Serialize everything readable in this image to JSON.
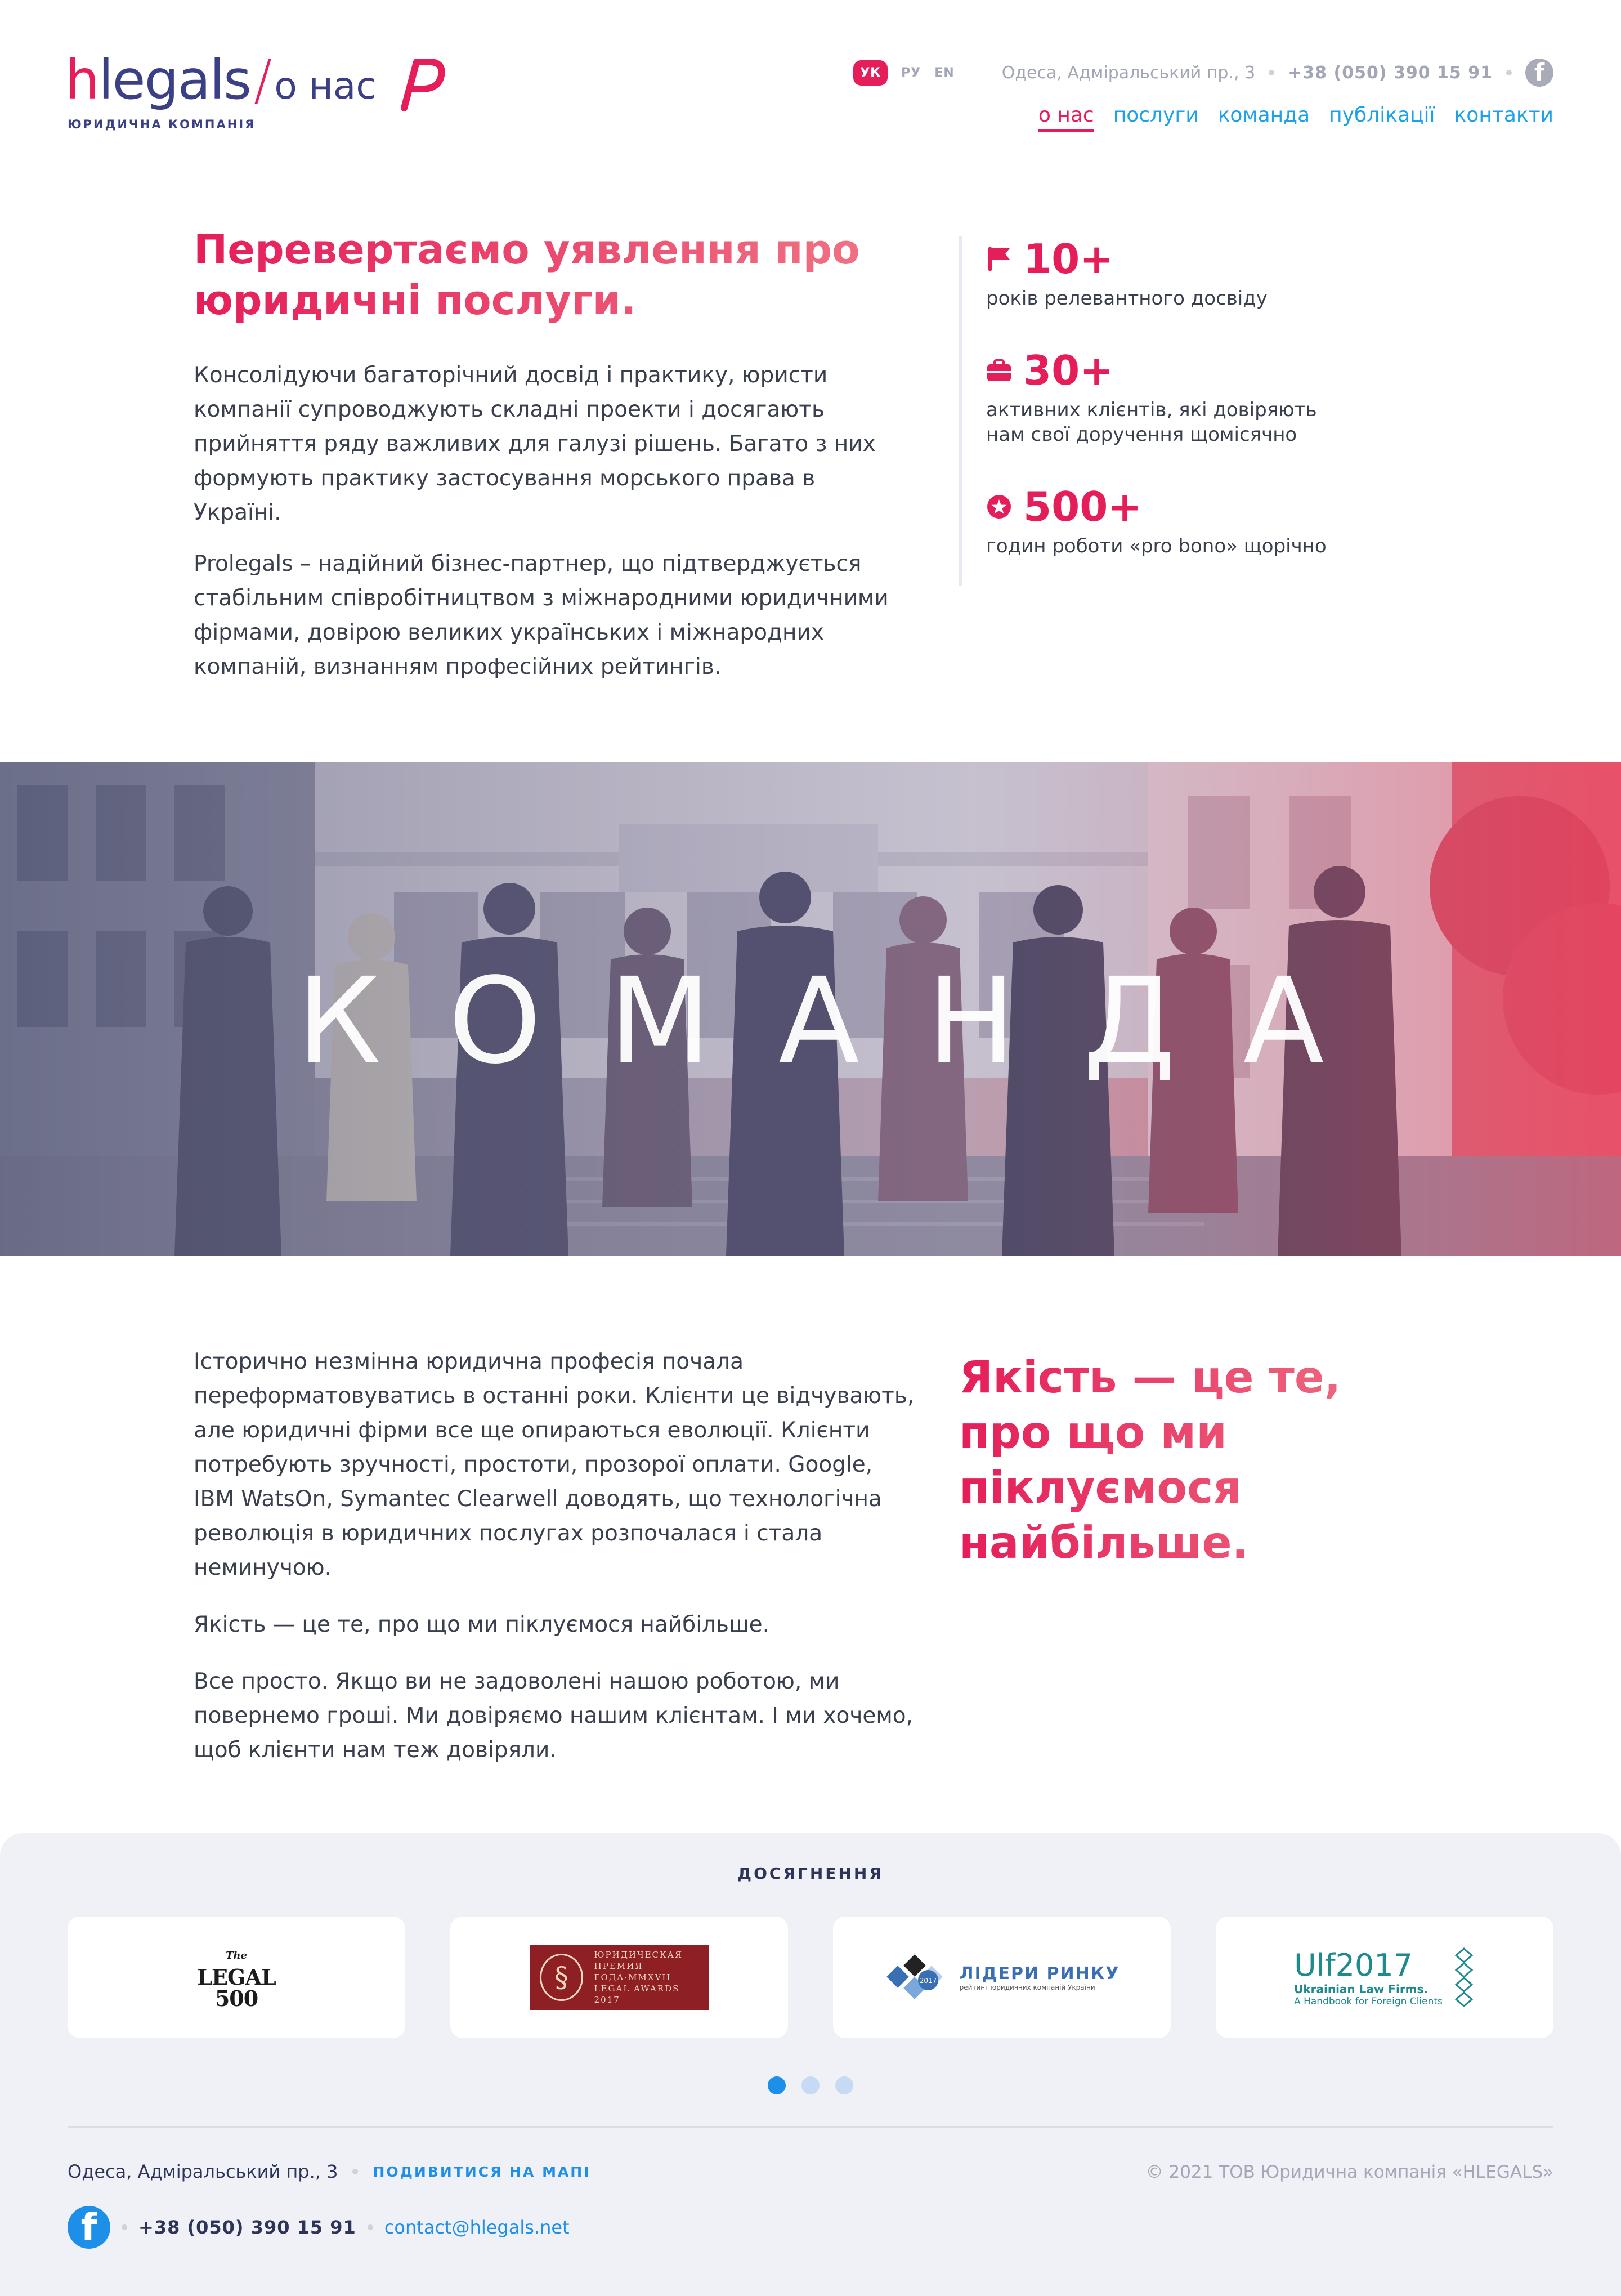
{
  "header": {
    "logo": {
      "prefix": "h",
      "name": "legals",
      "section": "о нас",
      "tagline": "ЮРИДИЧНА КОМПАНІЯ"
    },
    "languages": [
      {
        "code": "УК",
        "active": true
      },
      {
        "code": "РУ",
        "active": false
      },
      {
        "code": "EN",
        "active": false
      }
    ],
    "address": "Одеса, Адміральський пр., 3",
    "phone": "+38 (050) 390 15 91",
    "facebook_icon": "facebook-icon",
    "nav": [
      {
        "label": "о нас",
        "active": true
      },
      {
        "label": "послуги",
        "active": false
      },
      {
        "label": "команда",
        "active": false
      },
      {
        "label": "публікації",
        "active": false
      },
      {
        "label": "контакти",
        "active": false
      }
    ]
  },
  "intro": {
    "title": "Перевертаємо уявлення про юридичні послуги.",
    "paragraphs": [
      "Консолідуючи багаторічний досвід і практику, юристи компанії супроводжують складні проекти і досягають прийняття ряду важливих для галузі рішень. Багато з них формують практику застосування морського права в Україні.",
      "Prolegals – надійний бізнес-партнер, що підтверджується стабільним співробітництвом з міжнародними юридичними фірмами, довірою великих українських і міжнародних компаній, визнанням професійних рейтингів."
    ]
  },
  "stats": [
    {
      "icon": "flag-icon",
      "value": "10+",
      "label": "років релевантного досвіду"
    },
    {
      "icon": "briefcase-icon",
      "value": "30+",
      "label": "активних клієнтів, які довіряють нам свої доручення щомісячно"
    },
    {
      "icon": "star-icon",
      "value": "500+",
      "label": "годин роботи «pro bono» щорічно"
    }
  ],
  "banner": {
    "title": "КОМАНДА"
  },
  "quality": {
    "paragraphs": [
      "Історично незмінна юридична професія почала переформатовуватись в останні роки. Клієнти це відчувають, але юридичні фірми все ще опираються еволюції. Клієнти потребують зручності, простоти, прозорої оплати. Google, IBM WatsOn, Symantec Clearwell доводять, що технологічна революція в юридичних послугах розпочалася і стала неминучою.",
      "Якість — це те, про що ми піклуємося найбільше.",
      "Все просто. Якщо ви не задоволені нашою роботою, ми повернемо гроші. Ми довіряємо нашим клієнтам. І ми хочемо, щоб клієнти нам теж довіряли."
    ],
    "headline": "Якість — це те, про що ми піклуємося найбільше."
  },
  "achievements": {
    "title": "ДОСЯГНЕННЯ",
    "logos": {
      "legal500": {
        "the": "The",
        "line1": "LEGAL",
        "line2": "500"
      },
      "award": {
        "line1": "ЮРИДИЧЕСКАЯ",
        "line2": "ПРЕМИЯ",
        "line3": "ГОДА·MMXVII",
        "line4": "LEGAL AWARDS 2017"
      },
      "leaders": {
        "year": "2017",
        "title": "ЛІДЕРИ РИНКУ",
        "subtitle": "рейтинг юридичних компаній України"
      },
      "ulf": {
        "mark": "Ulf",
        "year": "2017",
        "line1": "Ukrainian Law Firms.",
        "line2": "A Handbook for Foreign Clients"
      }
    },
    "slider_pages": 3,
    "active_page": 1
  },
  "footer": {
    "address": "Одеса, Адміральський пр., 3",
    "map_link": "ПОДИВИТИСЯ НА МАПІ",
    "copyright": "© 2021 ТОВ Юридична компанія «HLEGALS»",
    "phone": "+38 (050) 390 15 91",
    "email": "contact@hlegals.net"
  },
  "colors": {
    "accent": "#e51d59",
    "link": "#1d8fe8",
    "brand_dark": "#3b3f86"
  }
}
